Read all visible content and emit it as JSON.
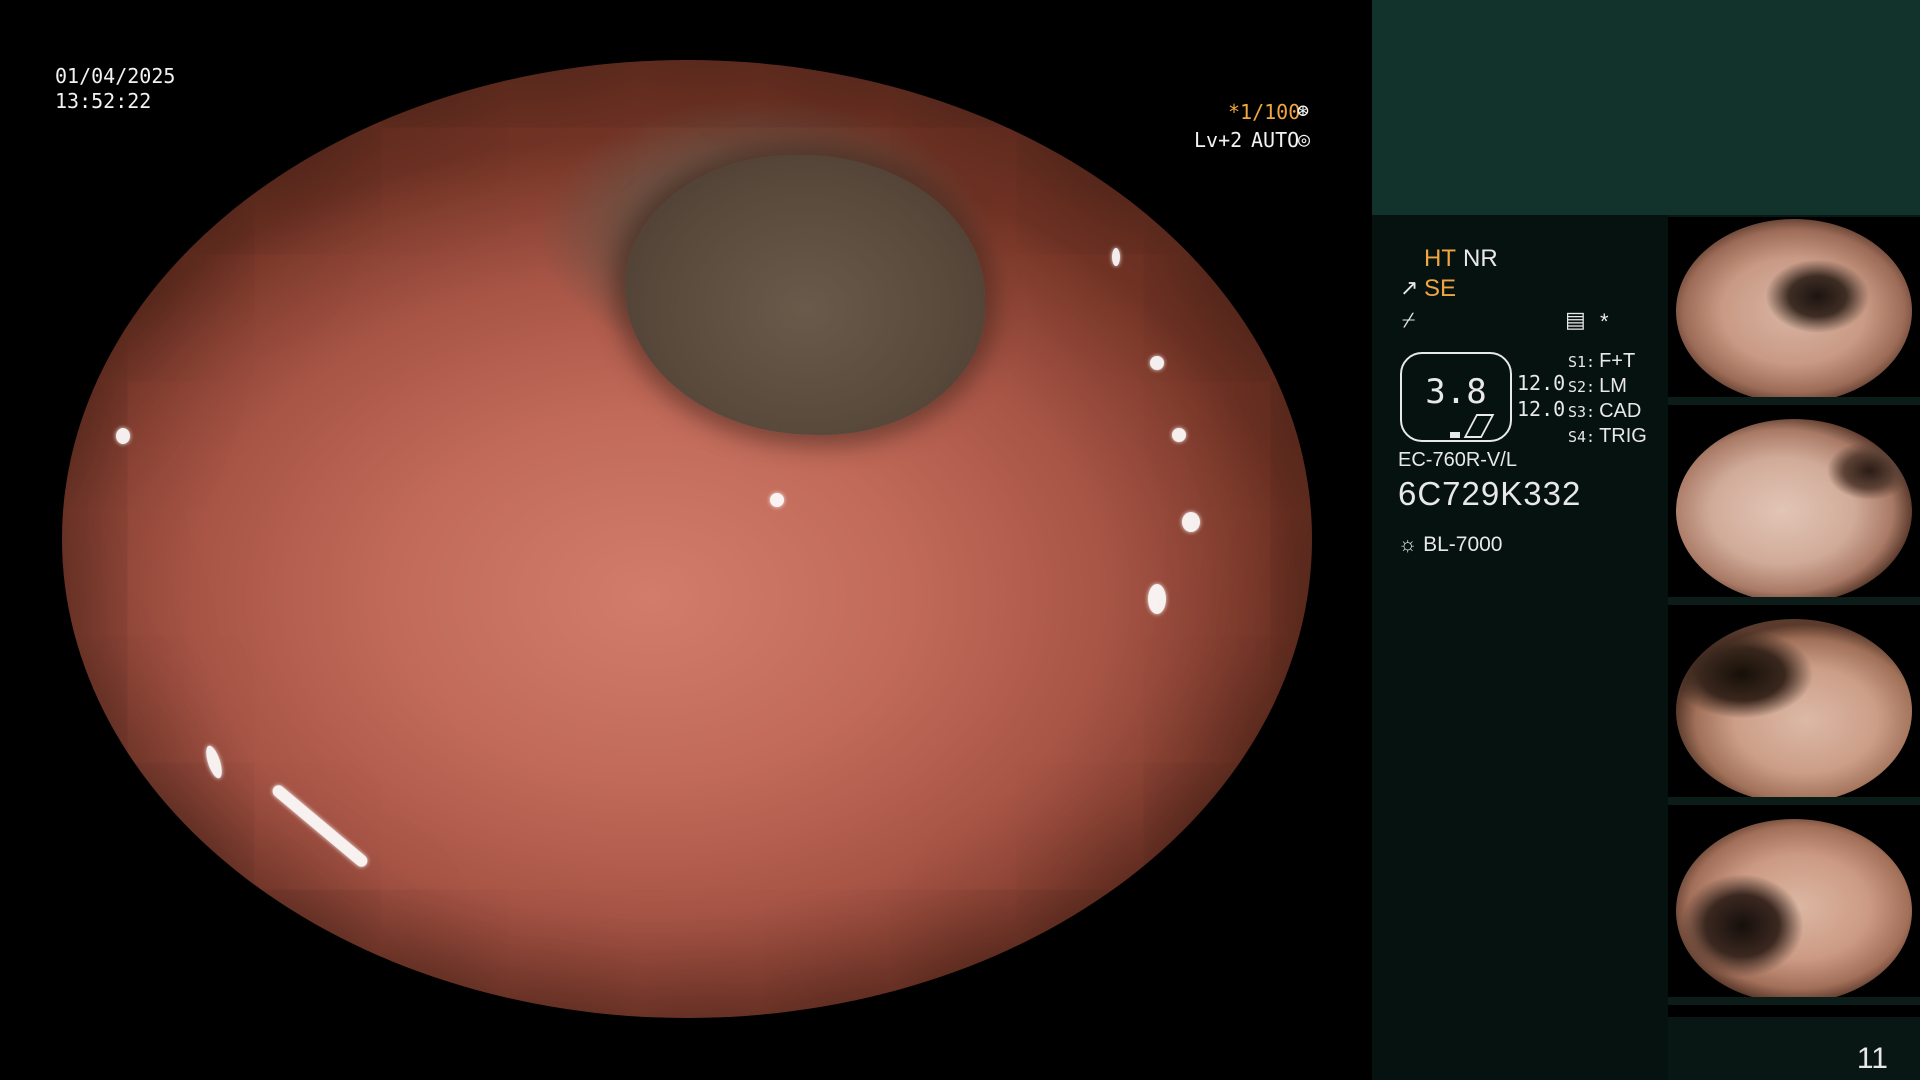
{
  "live_view": {
    "date": "01/04/2025",
    "time": "13:52:22",
    "shutter": "*1/100",
    "enhancement": "Lv+2",
    "iris_mode": "AUTO"
  },
  "info_panel": {
    "image_mode": {
      "hue_label": "HT",
      "noise_label": "NR",
      "enhancement_label": "SE"
    },
    "zoom_value": "3.8",
    "settings": {
      "top_value": "12.0",
      "bottom_value": "12.0"
    },
    "switches": [
      {
        "key": "S1:",
        "label": "F+T"
      },
      {
        "key": "S2:",
        "label": "LM"
      },
      {
        "key": "S3:",
        "label": "CAD"
      },
      {
        "key": "S4:",
        "label": "TRIG"
      }
    ],
    "scope_model": "EC-760R-V/L",
    "scope_serial": "6C729K332",
    "light_source": "BL-7000",
    "misc_symbol": "*",
    "page_number": "11"
  },
  "icons": {
    "shutter": "aperture-icon",
    "iris": "iris-icon",
    "enhancement": "structure-enhancement-icon",
    "contrast": "contrast-icon",
    "settings": "settings-icon",
    "light": "light-icon"
  },
  "colors": {
    "highlight": "#f0a640",
    "panel_top": "#12322c",
    "panel_bottom": "#06120f"
  }
}
